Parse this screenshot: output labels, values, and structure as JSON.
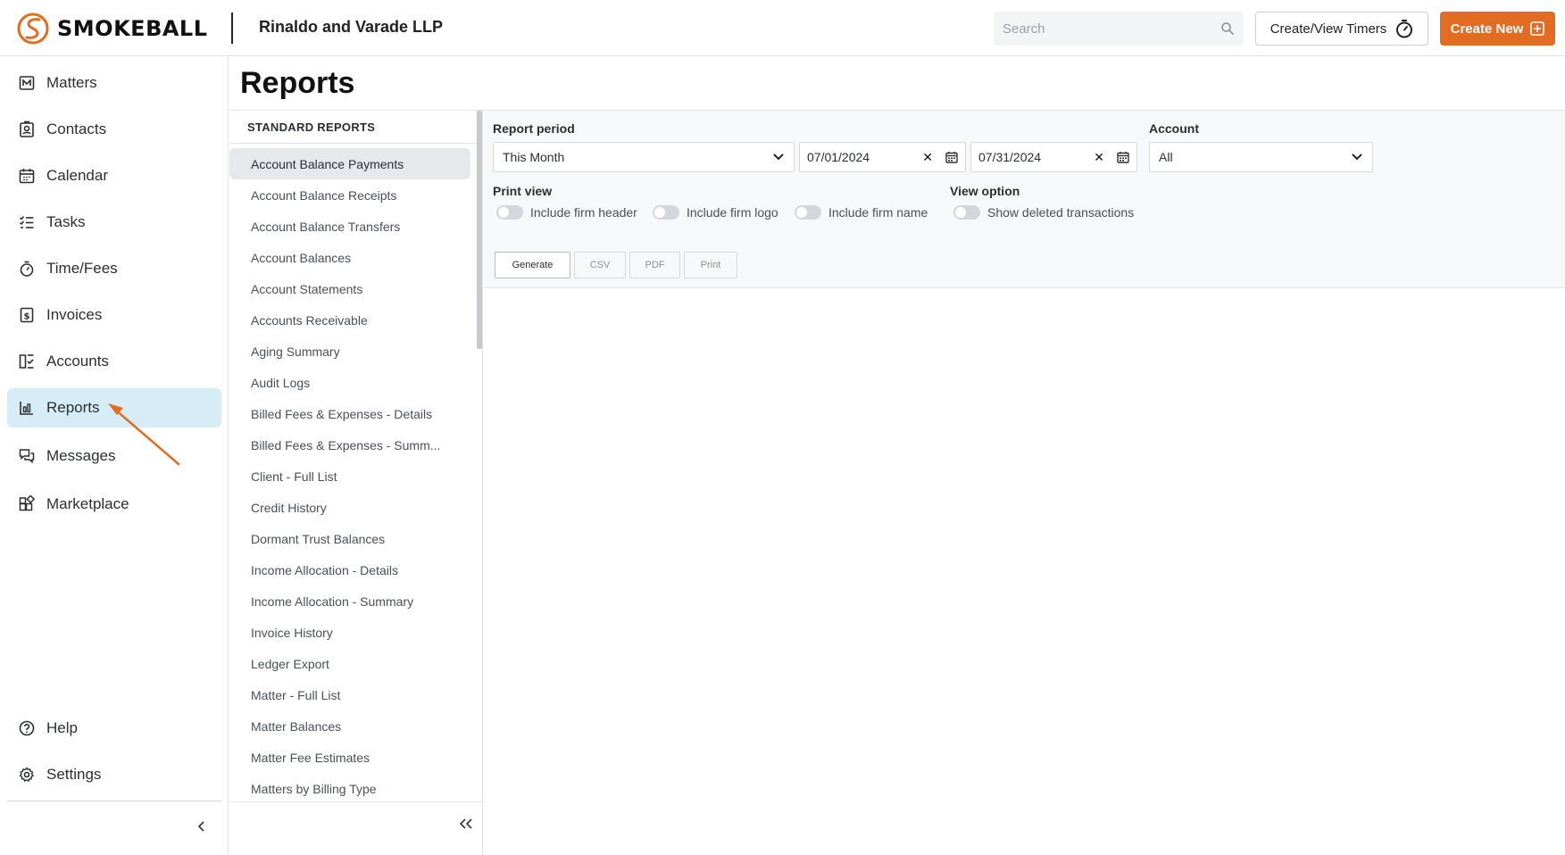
{
  "header": {
    "logo_text": "SMOKEBALL",
    "firm_name": "Rinaldo and Varade LLP",
    "search_placeholder": "Search",
    "timers_label": "Create/View Timers",
    "create_label": "Create New"
  },
  "colors": {
    "accent": "#e26d22",
    "active_nav": "#d6edf7",
    "active_report": "#e6e8ec"
  },
  "sidebar": {
    "items": [
      {
        "label": "Matters",
        "icon": "matters-icon"
      },
      {
        "label": "Contacts",
        "icon": "contacts-icon"
      },
      {
        "label": "Calendar",
        "icon": "calendar-icon"
      },
      {
        "label": "Tasks",
        "icon": "tasks-icon"
      },
      {
        "label": "Time/Fees",
        "icon": "stopwatch-icon"
      },
      {
        "label": "Invoices",
        "icon": "invoice-icon"
      },
      {
        "label": "Accounts",
        "icon": "accounts-icon"
      },
      {
        "label": "Reports",
        "icon": "chart-icon",
        "active": true
      },
      {
        "label": "Messages",
        "icon": "messages-icon"
      },
      {
        "label": "Marketplace",
        "icon": "marketplace-icon"
      }
    ],
    "bottom_items": [
      {
        "label": "Help",
        "icon": "help-icon"
      },
      {
        "label": "Settings",
        "icon": "gear-icon"
      }
    ]
  },
  "page": {
    "title": "Reports"
  },
  "reports": {
    "header": "STANDARD REPORTS",
    "items": [
      "Account Balance Payments",
      "Account Balance Receipts",
      "Account Balance Transfers",
      "Account Balances",
      "Account Statements",
      "Accounts Receivable",
      "Aging Summary",
      "Audit Logs",
      "Billed Fees & Expenses - Details",
      "Billed Fees & Expenses - Summ...",
      "Client - Full List",
      "Credit History",
      "Dormant Trust Balances",
      "Income Allocation - Details",
      "Income Allocation - Summary",
      "Invoice History",
      "Ledger Export",
      "Matter - Full List",
      "Matter Balances",
      "Matter Fee Estimates",
      "Matters by Billing Type"
    ],
    "selected": "Account Balance Payments"
  },
  "filters": {
    "report_period_label": "Report period",
    "report_period_value": "This Month",
    "start_date": "07/01/2024",
    "end_date": "07/31/2024",
    "account_label": "Account",
    "account_value": "All",
    "print_view_label": "Print view",
    "toggles": [
      "Include firm header",
      "Include firm logo",
      "Include firm name"
    ],
    "view_option_label": "View option",
    "view_toggle": "Show deleted transactions",
    "buttons": {
      "generate": "Generate",
      "csv": "CSV",
      "pdf": "PDF",
      "print": "Print"
    }
  }
}
